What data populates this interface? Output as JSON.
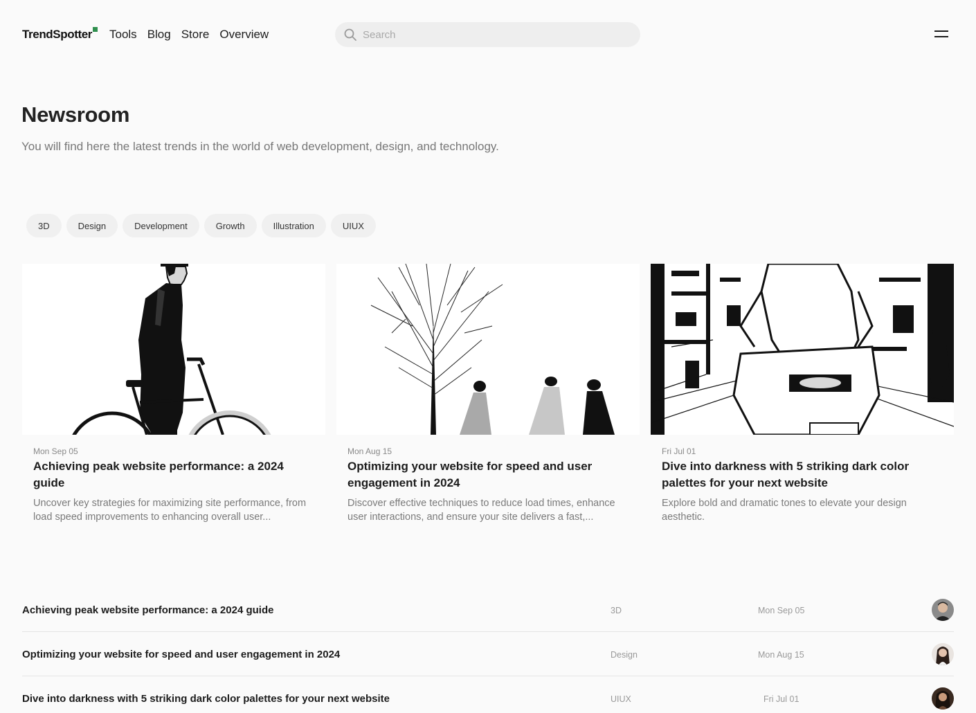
{
  "header": {
    "logo": "TrendSpotter",
    "nav": [
      "Tools",
      "Blog",
      "Store",
      "Overview"
    ],
    "search_placeholder": "Search"
  },
  "hero": {
    "title": "Newsroom",
    "subtitle": "You will find here the latest trends in the world of web development, design, and technology."
  },
  "tags": [
    "3D",
    "Design",
    "Development",
    "Growth",
    "Illustration",
    "UIUX"
  ],
  "cards": [
    {
      "date": "Mon Sep 05",
      "title": "Achieving peak website performance: a 2024 guide",
      "desc": "Uncover key strategies for maximizing site performance, from load speed improvements to enhancing overall user..."
    },
    {
      "date": "Mon Aug 15",
      "title": "Optimizing your website for speed and user engagement in 2024",
      "desc": "Discover effective techniques to reduce load times, enhance user interactions, and ensure your site delivers a fast,..."
    },
    {
      "date": "Fri Jul 01",
      "title": "Dive into darkness with 5 striking dark color palettes for your next website",
      "desc": "Explore bold and dramatic tones to elevate your design aesthetic."
    }
  ],
  "list": [
    {
      "title": "Achieving peak website performance: a 2024 guide",
      "category": "3D",
      "date": "Mon Sep 05"
    },
    {
      "title": "Optimizing your website for speed and user engagement in 2024",
      "category": "Design",
      "date": "Mon Aug 15"
    },
    {
      "title": "Dive into darkness with 5 striking dark color palettes for your next website",
      "category": "UIUX",
      "date": "Fri Jul 01"
    }
  ],
  "colors": {
    "accent": "#2f8f4e",
    "background": "#fafafa",
    "tag_bg": "#f0f0f0"
  }
}
